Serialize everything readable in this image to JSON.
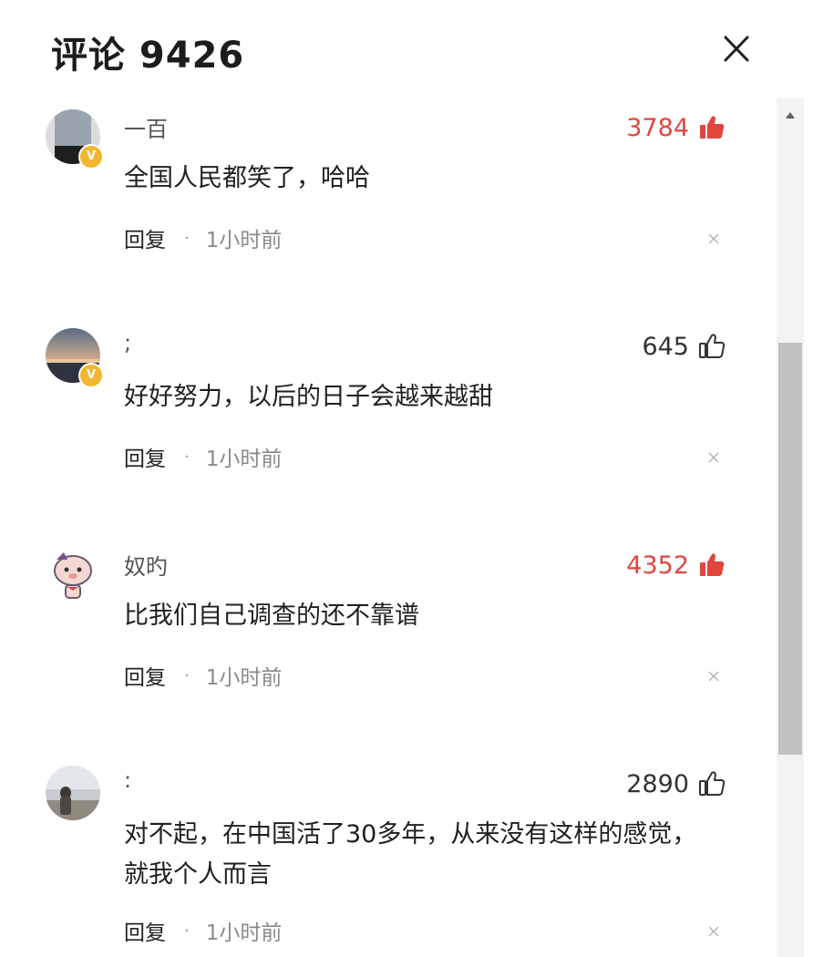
{
  "header": {
    "title": "评论 9426"
  },
  "comments": [
    {
      "username": "一百",
      "likes": "3784",
      "liked": true,
      "text": "全国人民都笑了，哈哈",
      "reply_label": "回复",
      "separator": "·",
      "time": "1小时前"
    },
    {
      "username": ";",
      "likes": "645",
      "liked": false,
      "text": "好好努力，以后的日子会越来越甜",
      "reply_label": "回复",
      "separator": "·",
      "time": "1小时前"
    },
    {
      "username": "奴旳",
      "likes": "4352",
      "liked": true,
      "text": "比我们自己调查的还不靠谱",
      "reply_label": "回复",
      "separator": "·",
      "time": "1小时前"
    },
    {
      "username": ":",
      "likes": "2890",
      "liked": false,
      "text_line1": "对不起，在中国活了30多年，从来没有这样的感觉，",
      "text_line2": "就我个人而言",
      "reply_label": "回复",
      "separator": "·",
      "time": "1小时前"
    }
  ],
  "colors": {
    "liked": "#e0463e",
    "normal": "#333333",
    "badge": "#f2b630"
  },
  "icons": {
    "close": "close-icon",
    "like": "thumbs-up-icon",
    "dismiss": "dismiss-x-icon",
    "scroll_up": "triangle-up-icon",
    "verified": "v-badge-icon"
  },
  "badge_letter": "V"
}
